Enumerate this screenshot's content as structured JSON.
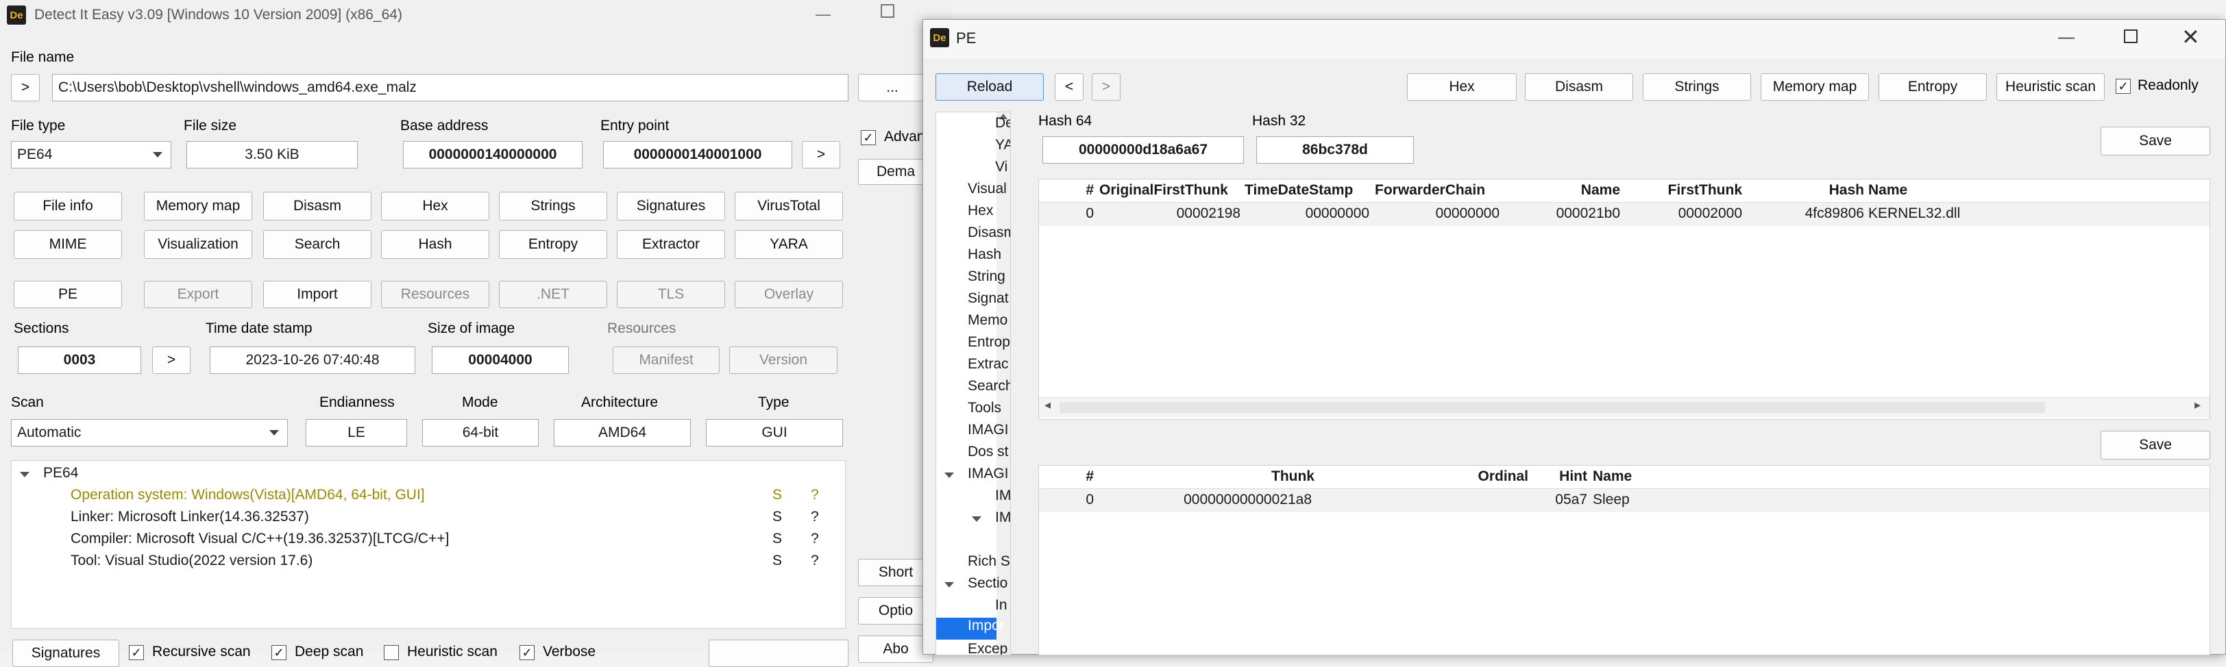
{
  "main": {
    "title": "Detect It Easy v3.09 [Windows 10 Version 2009] (x86_64)",
    "file_name_label": "File name",
    "file_path": "C:\\Users\\bob\\Desktop\\vshell\\windows_amd64.exe_malz",
    "browse_label": "...",
    "arrow_label": ">",
    "file_type_label": "File type",
    "file_type_value": "PE64",
    "file_size_label": "File size",
    "file_size_value": "3.50 KiB",
    "base_address_label": "Base address",
    "base_address_value": "0000000140000000",
    "entry_point_label": "Entry point",
    "entry_point_value": "0000000140001000",
    "advanced_label": "Advan",
    "demangle_label": "Dema",
    "buttons_row1": [
      "File info",
      "Memory map",
      "Disasm",
      "Hex",
      "Strings",
      "Signatures",
      "VirusTotal"
    ],
    "buttons_row2": [
      "MIME",
      "Visualization",
      "Search",
      "Hash",
      "Entropy",
      "Extractor",
      "YARA"
    ],
    "pe_buttons": [
      "PE",
      "Export",
      "Import",
      "Resources",
      ".NET",
      "TLS",
      "Overlay"
    ],
    "sections_label": "Sections",
    "sections_value": "0003",
    "time_label": "Time date stamp",
    "time_value": "2023-10-26 07:40:48",
    "size_image_label": "Size of image",
    "size_image_value": "00004000",
    "resources_label": "Resources",
    "manifest_label": "Manifest",
    "version_label": "Version",
    "scan_label": "Scan",
    "scan_value": "Automatic",
    "endianness_label": "Endianness",
    "endianness_value": "LE",
    "mode_label": "Mode",
    "mode_value": "64-bit",
    "arch_label": "Architecture",
    "arch_value": "AMD64",
    "type_label": "Type",
    "type_value": "GUI",
    "result_root": "PE64",
    "results": [
      {
        "text": "Operation system: Windows(Vista)[AMD64, 64-bit, GUI]",
        "s": "S",
        "q": "?"
      },
      {
        "text": "Linker: Microsoft Linker(14.36.32537)",
        "s": "S",
        "q": "?"
      },
      {
        "text": "Compiler: Microsoft Visual C/C++(19.36.32537)[LTCG/C++]",
        "s": "S",
        "q": "?"
      },
      {
        "text": "Tool: Visual Studio(2022 version 17.6)",
        "s": "S",
        "q": "?"
      }
    ],
    "short_label": "Short",
    "options_label": "Optio",
    "about_label": "Abo",
    "bottom": {
      "signatures_label": "Signatures",
      "recursive_label": "Recursive scan",
      "deep_label": "Deep scan",
      "heuristic_label": "Heuristic scan",
      "verbose_label": "Verbose"
    }
  },
  "pe": {
    "title": "PE",
    "logo_text": "De",
    "reload_label": "Reload",
    "back_label": "<",
    "forward_label": ">",
    "tool_buttons": [
      "Hex",
      "Disasm",
      "Strings",
      "Memory map",
      "Entropy",
      "Heuristic scan"
    ],
    "readonly_label": "Readonly",
    "hash64_label": "Hash 64",
    "hash64_value": "00000000d18a6a67",
    "hash32_label": "Hash 32",
    "hash32_value": "86bc378d",
    "save_label": "Save",
    "tree": [
      "De",
      "YA",
      "Vi",
      "Visual",
      "Hex",
      "Disasm",
      "Hash",
      "String",
      "Signat",
      "Memo",
      "Entrop",
      "Extrac",
      "Search",
      "Tools",
      "IMAGI",
      "Dos st",
      "IMAGI",
      "IM",
      "IM",
      "Rich S",
      "Sectio",
      "In",
      "Impor",
      "Excep"
    ],
    "table1": {
      "headers": [
        "#",
        "OriginalFirstThunk",
        "TimeDateStamp",
        "ForwarderChain",
        "Name",
        "FirstThunk",
        "Hash",
        "Name"
      ],
      "rows": [
        [
          "0",
          "00002198",
          "00000000",
          "00000000",
          "000021b0",
          "00002000",
          "4fc89806",
          "KERNEL32.dll"
        ]
      ]
    },
    "table2": {
      "headers": [
        "#",
        "Thunk",
        "Ordinal",
        "Hint",
        "Name"
      ],
      "rows": [
        [
          "0",
          "00000000000021a8",
          "",
          "05a7",
          "Sleep"
        ]
      ]
    }
  }
}
